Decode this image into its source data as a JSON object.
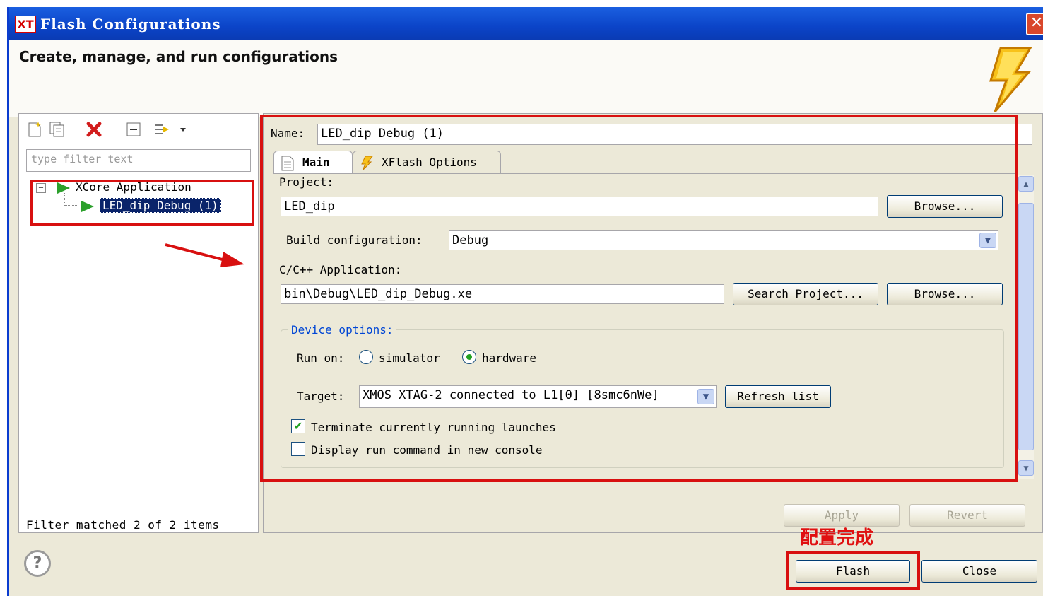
{
  "window": {
    "logo": "XT",
    "title": "Flash Configurations",
    "close_glyph": "✕",
    "header_text": "Create, manage, and run configurations",
    "header_icon": "lightning-bolt-icon"
  },
  "left_panel": {
    "toolbar_icons": [
      "new-config-icon",
      "duplicate-icon",
      "delete-icon",
      "collapse-all-icon",
      "filter-icon",
      "dropdown-icon"
    ],
    "filter_placeholder": "type filter text",
    "tree": {
      "parent": "XCore Application",
      "expander": "−",
      "child": "LED_dip Debug (1)"
    },
    "status": "Filter matched 2 of 2 items"
  },
  "right_panel": {
    "name_label": "Name:",
    "name_value": "LED_dip Debug (1)",
    "tabs": [
      {
        "label": "Main",
        "icon": "document-icon",
        "active": true
      },
      {
        "label": "XFlash Options",
        "icon": "lightning-icon",
        "active": false
      }
    ],
    "main": {
      "project_label": "Project:",
      "project_value": "LED_dip",
      "browse_label": "Browse...",
      "build_config_label": "Build configuration:",
      "build_config_value": "Debug",
      "app_label": "C/C++ Application:",
      "app_value": "bin\\Debug\\LED_dip_Debug.xe",
      "search_project_label": "Search Project...",
      "browse2_label": "Browse...",
      "device_options": {
        "title": "Device options:",
        "run_on_label": "Run on:",
        "simulator_label": "simulator",
        "hardware_label": "hardware",
        "run_on_selected": "hardware",
        "target_label": "Target:",
        "target_value": "XMOS XTAG-2 connected to L1[0] [8smc6nWe]",
        "refresh_label": "Refresh list",
        "terminate_label": "Terminate currently running launches",
        "terminate_checked": true,
        "console_label": "Display run command in new console",
        "console_checked": false
      }
    },
    "apply_label": "Apply",
    "revert_label": "Revert"
  },
  "footer": {
    "help_glyph": "?",
    "annotation": "配置完成",
    "flash_label": "Flash",
    "close_label": "Close"
  },
  "colors": {
    "titlebar": "#0b44c8",
    "highlight_box": "#d81010",
    "dialog_bg": "#ece9d8",
    "selection": "#0a246a"
  }
}
